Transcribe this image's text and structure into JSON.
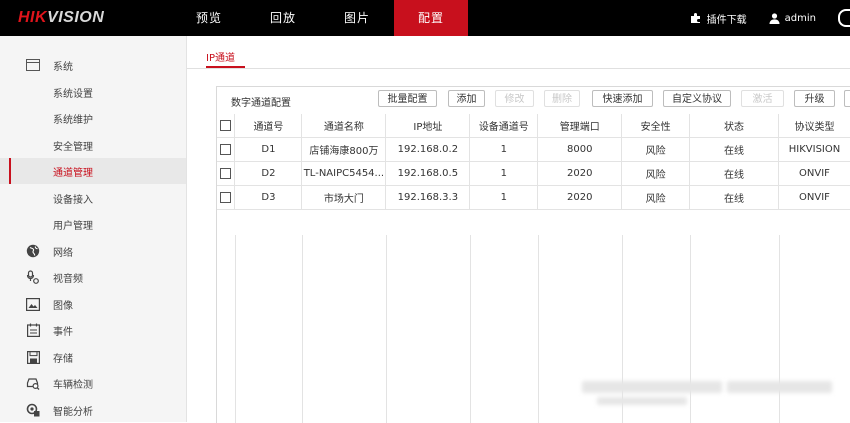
{
  "brand": {
    "logo_prefix": "HIK",
    "logo_suffix": "VISION",
    "accent": "#c8101d"
  },
  "nav": {
    "items": [
      "预览",
      "回放",
      "图片",
      "配置"
    ],
    "active": "配置"
  },
  "top_right": {
    "plugin": "插件下载",
    "user": "admin"
  },
  "sidebar": {
    "items": [
      {
        "label": "系统",
        "icon": "system-icon",
        "level": 1
      },
      {
        "label": "系统设置",
        "level": 2
      },
      {
        "label": "系统维护",
        "level": 2
      },
      {
        "label": "安全管理",
        "level": 2
      },
      {
        "label": "通道管理",
        "level": 2,
        "active": true
      },
      {
        "label": "设备接入",
        "level": 2
      },
      {
        "label": "用户管理",
        "level": 2
      },
      {
        "label": "网络",
        "icon": "network-globe-icon",
        "level": 1
      },
      {
        "label": "视音频",
        "icon": "audio-video-icon",
        "level": 1
      },
      {
        "label": "图像",
        "icon": "image-icon",
        "level": 1
      },
      {
        "label": "事件",
        "icon": "event-calendar-icon",
        "level": 1
      },
      {
        "label": "存储",
        "icon": "storage-icon",
        "level": 1
      },
      {
        "label": "车辆检测",
        "icon": "vehicle-detection-icon",
        "level": 1
      },
      {
        "label": "智能分析",
        "icon": "smart-analysis-icon",
        "level": 1
      }
    ]
  },
  "main": {
    "tab": "IP通道",
    "panel_title": "数字通道配置",
    "buttons": [
      {
        "label": "批量配置",
        "disabled": false
      },
      {
        "label": "添加",
        "disabled": false
      },
      {
        "label": "修改",
        "disabled": true
      },
      {
        "label": "删除",
        "disabled": true
      },
      {
        "label": "快速添加",
        "disabled": false
      },
      {
        "label": "自定义协议",
        "disabled": false
      },
      {
        "label": "激活",
        "disabled": true
      },
      {
        "label": "升级",
        "disabled": false
      }
    ],
    "table": {
      "columns": [
        "通道号",
        "通道名称",
        "IP地址",
        "设备通道号",
        "管理端口",
        "安全性",
        "状态",
        "协议类型"
      ],
      "rows": [
        [
          "D1",
          "店铺海康800万",
          "192.168.0.2",
          "1",
          "8000",
          "风险",
          "在线",
          "HIKVISION"
        ],
        [
          "D2",
          "TL-NAIPC5454...",
          "192.168.0.5",
          "1",
          "2020",
          "风险",
          "在线",
          "ONVIF"
        ],
        [
          "D3",
          "市场大门",
          "192.168.3.3",
          "1",
          "2020",
          "风险",
          "在线",
          "ONVIF"
        ]
      ]
    }
  }
}
